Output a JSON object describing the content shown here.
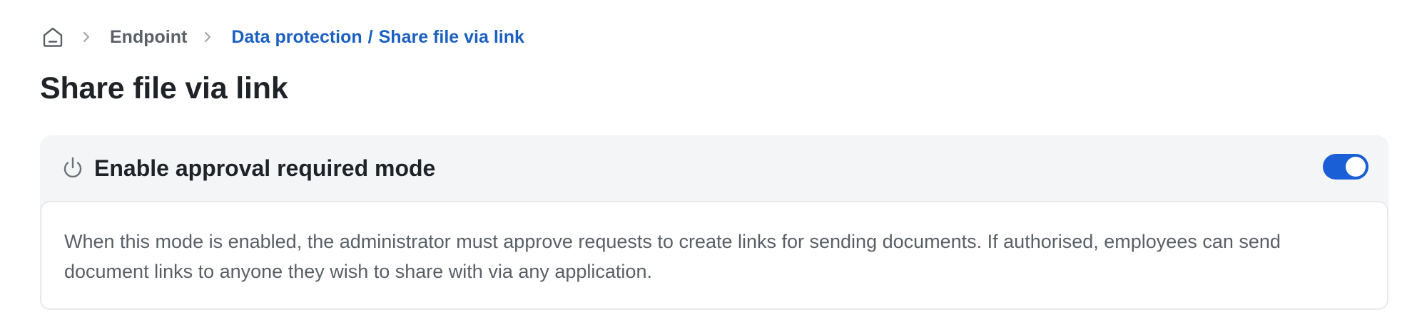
{
  "breadcrumb": {
    "home_icon": "home-icon",
    "separator_icon": "chevron-right-icon",
    "endpoint_label": "Endpoint",
    "data_protection_label": "Data protection",
    "slash": "/",
    "current_label": "Share file via link"
  },
  "page": {
    "title": "Share file via link"
  },
  "card": {
    "icon": "power-icon",
    "title": "Enable approval required mode",
    "toggle_on": true,
    "description": "When this mode is enabled, the administrator must approve requests to create links for sending documents. If authorised, employees can send document links to anyone they wish to share with via any application."
  },
  "colors": {
    "accent": "#1a5fd6",
    "link": "#1b5fc1",
    "card_bg": "#f4f5f6",
    "text_primary": "#1f2328",
    "text_secondary": "#5a5f66"
  }
}
